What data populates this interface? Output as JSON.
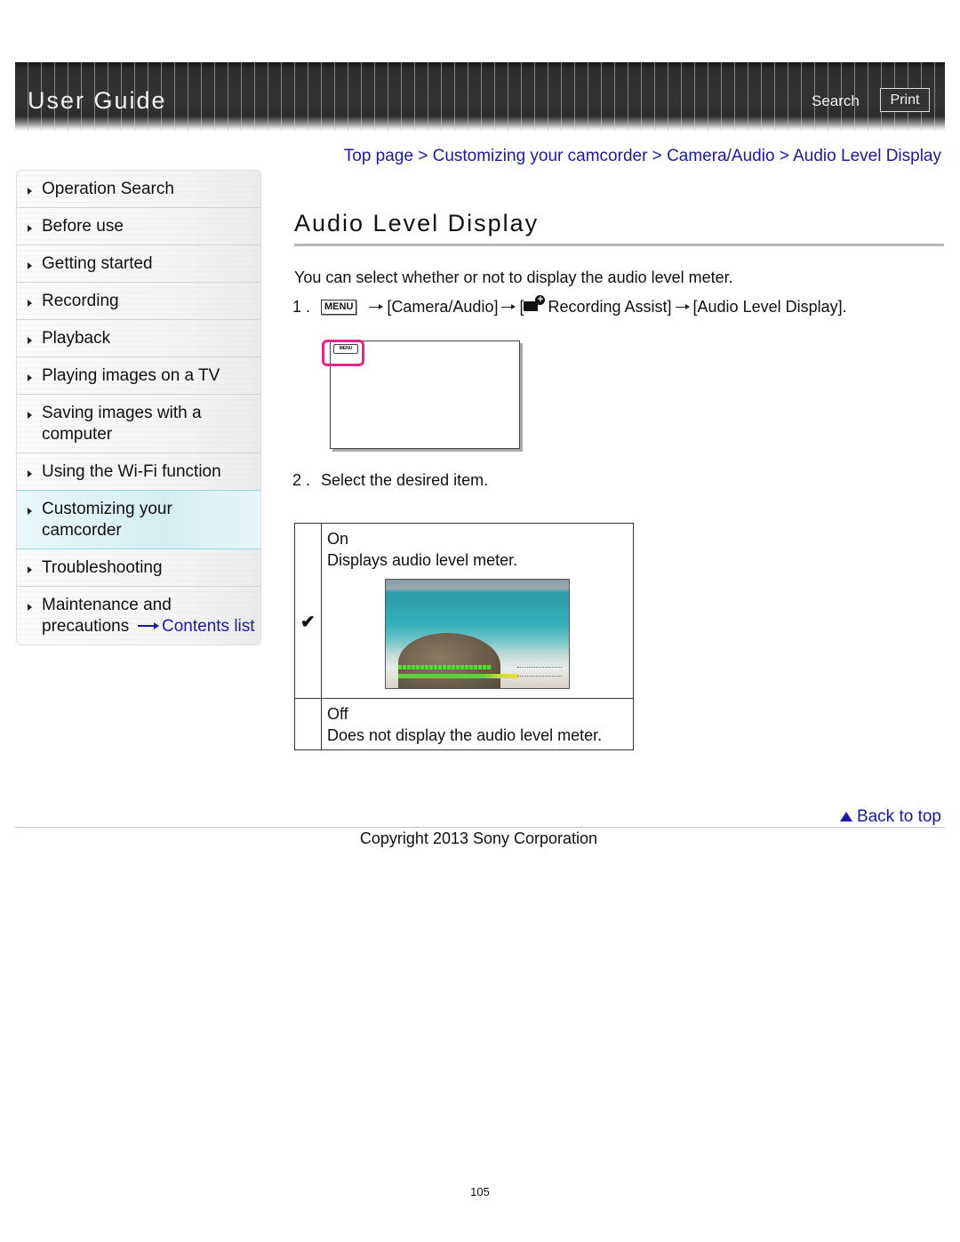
{
  "header": {
    "title": "User Guide",
    "search_label": "Search",
    "print_label": "Print"
  },
  "sidebar": {
    "items": [
      {
        "label": "Operation Search",
        "active": false
      },
      {
        "label": "Before use",
        "active": false
      },
      {
        "label": "Getting started",
        "active": false
      },
      {
        "label": "Recording",
        "active": false
      },
      {
        "label": "Playback",
        "active": false
      },
      {
        "label": "Playing images on a TV",
        "active": false
      },
      {
        "label": "Saving images with a computer",
        "active": false
      },
      {
        "label": "Using the Wi-Fi function",
        "active": false
      },
      {
        "label": "Customizing your camcorder",
        "active": true
      },
      {
        "label": "Troubleshooting",
        "active": false
      },
      {
        "label": "Maintenance and precautions",
        "active": false
      }
    ],
    "contents_link": "Contents list"
  },
  "breadcrumb": {
    "items": [
      "Top page",
      "Customizing your camcorder",
      "Camera/Audio",
      "Audio Level Display"
    ],
    "separator": " > "
  },
  "main": {
    "title": "Audio Level Display",
    "intro": "You can select whether or not to display the audio level meter.",
    "step1": {
      "number": "1 .",
      "menu_key": "MENU",
      "part1": "[Camera/Audio]",
      "part2_open": "[",
      "part2_text": "Recording Assist]",
      "part3": "[Audio Level Display]."
    },
    "figure_menu_label": "MENU",
    "step2": {
      "number": "2 .",
      "text": "Select the desired item."
    },
    "options": [
      {
        "name": "On",
        "description": "Displays audio level meter.",
        "selected": true
      },
      {
        "name": "Off",
        "description": "Does not display the audio level meter.",
        "selected": false
      }
    ],
    "checkmark": "✔"
  },
  "footer": {
    "back_to_top": "Back to top",
    "copyright": "Copyright 2013 Sony Corporation",
    "page_number": "105"
  },
  "colors": {
    "link": "#1a1aa6",
    "highlight": "#e8268a",
    "active_nav_border": "#8fdbe8"
  }
}
